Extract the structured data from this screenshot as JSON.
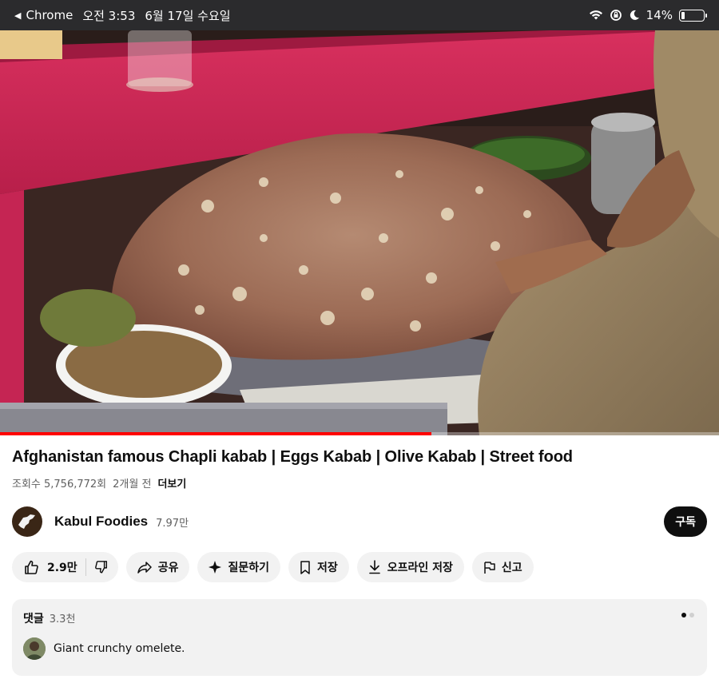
{
  "status_bar": {
    "app": "Chrome",
    "time": "오전 3:53",
    "date": "6월 17일 수요일",
    "battery": "14%",
    "battery_level": 0.14
  },
  "video": {
    "progress": 0.6
  },
  "details": {
    "title": "Afghanistan famous Chapli kabab | Eggs Kabab | Olive Kabab | Street food",
    "views": "조회수 5,756,772회",
    "age": "2개월 전",
    "more": "더보기"
  },
  "channel": {
    "name": "Kabul Foodies",
    "subscribers": "7.97만",
    "subscribe_label": "구독"
  },
  "actions": {
    "like_count": "2.9만",
    "share": "공유",
    "ask": "질문하기",
    "save": "저장",
    "offline": "오프라인 저장",
    "report": "신고"
  },
  "comments": {
    "label": "댓글",
    "count": "3.3천",
    "first": "Giant crunchy omelete."
  },
  "colors": {
    "progress": "#ff0000",
    "subscribe_bg": "#0f0f0f",
    "pill_bg": "#f2f2f2"
  }
}
